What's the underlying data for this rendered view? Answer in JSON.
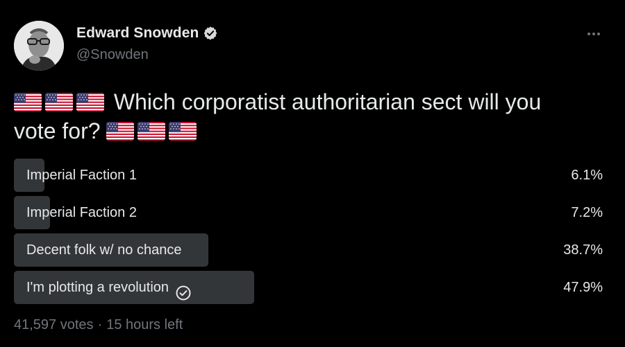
{
  "author": {
    "display_name": "Edward Snowden",
    "handle": "@Snowden",
    "verified_icon": "verified-badge-icon",
    "avatar_icon": "avatar-photo"
  },
  "tweet": {
    "text_main": "Which corporatist authoritarian sect will you",
    "text_end": "vote for?",
    "emoji": "us-flag-icon"
  },
  "poll": {
    "options": [
      {
        "label": "Imperial Faction 1",
        "percent": "6.1%",
        "value": 6.1,
        "selected": false
      },
      {
        "label": "Imperial Faction 2",
        "percent": "7.2%",
        "value": 7.2,
        "selected": false
      },
      {
        "label": "Decent folk w/ no chance",
        "percent": "38.7%",
        "value": 38.7,
        "selected": false
      },
      {
        "label": "I'm plotting a revolution",
        "percent": "47.9%",
        "value": 47.9,
        "selected": true
      }
    ],
    "votes": "41,597 votes",
    "separator": "·",
    "time_left": "15 hours left"
  },
  "colors": {
    "background": "#000000",
    "text": "#e7e9ea",
    "secondary_text": "#71767b",
    "poll_bar": "#333639",
    "verified": "#d9d9d9"
  }
}
